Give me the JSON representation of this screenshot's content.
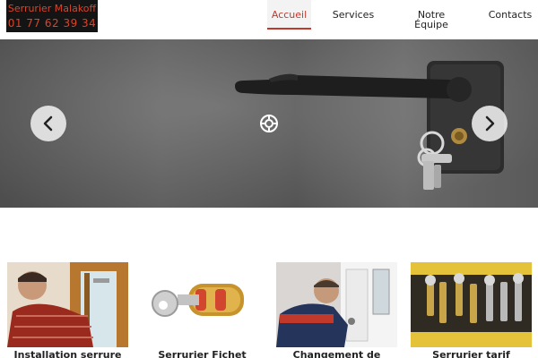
{
  "header": {
    "logo_line1": "Serrurier Malakoff",
    "logo_line2": "01 77 62 39 34",
    "nav": {
      "accueil": "Accueil",
      "services": "Services",
      "equipe_line1": "Notre",
      "equipe_line2": "Équipe",
      "contacts": "Contacts"
    }
  },
  "hero": {
    "prev_icon": "chevron-left-icon",
    "next_icon": "chevron-right-icon",
    "center_icon": "target-icon"
  },
  "cards": [
    {
      "title": "Installation serrure"
    },
    {
      "title": "Serrurier Fichet"
    },
    {
      "title": "Changement de"
    },
    {
      "title": "Serrurier tarif"
    }
  ],
  "colors": {
    "accent": "#c0392b",
    "logo_bg": "#141414",
    "logo_text": "#d7452a"
  }
}
